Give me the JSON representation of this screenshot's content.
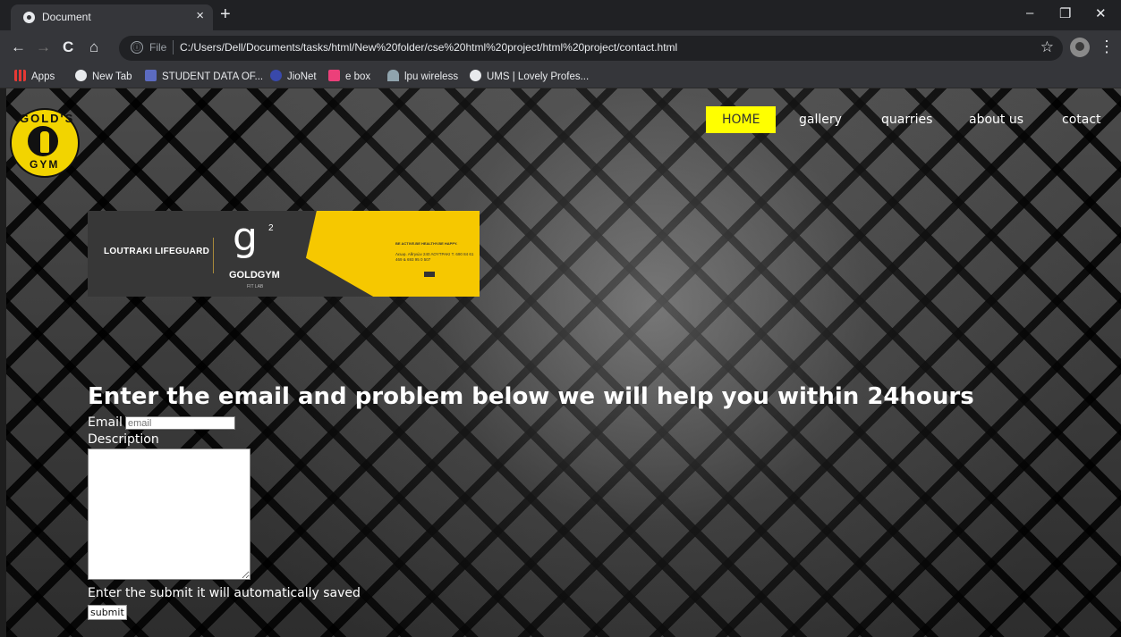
{
  "browser": {
    "tab_title": "Document",
    "tab_close": "×",
    "new_tab": "+",
    "window_controls": {
      "minimize": "–",
      "restore": "❐",
      "close": "✕"
    },
    "nav": {
      "back": "←",
      "forward": "→",
      "reload": "C",
      "home": "⌂"
    },
    "omnibox": {
      "info_icon": "ⓘ",
      "scheme": "File",
      "url": "C:/Users/Dell/Documents/tasks/html/New%20folder/cse%20html%20project/html%20project/contact.html",
      "star": "☆"
    },
    "menu": "⋮",
    "bookmarks": [
      {
        "label": "Apps",
        "icon": "apps-grid-icon",
        "color": "#e53935"
      },
      {
        "label": "New Tab",
        "icon": "globe-icon",
        "color": "#e8eaed"
      },
      {
        "label": "STUDENT DATA OF...",
        "icon": "list-icon",
        "color": "#5c6bc0"
      },
      {
        "label": "JioNet",
        "icon": "jio-icon",
        "color": "#3949ab"
      },
      {
        "label": "e box",
        "icon": "ebox-icon",
        "color": "#ec407a"
      },
      {
        "label": "lpu wireless",
        "icon": "wifi-icon",
        "color": "#90a4ae"
      },
      {
        "label": "UMS | Lovely Profes...",
        "icon": "globe-icon",
        "color": "#e8eaed"
      }
    ]
  },
  "site": {
    "logo": {
      "text_top": "GOLD'S",
      "text_bottom": "GYM"
    },
    "nav": [
      {
        "label": "HOME",
        "active": true
      },
      {
        "label": "gallery",
        "active": false
      },
      {
        "label": "quarries",
        "active": false
      },
      {
        "label": "about us",
        "active": false
      },
      {
        "label": "cotact",
        "active": false
      }
    ],
    "banner": {
      "left_text": "LOUTRAKI LIFEGUARD",
      "g_mark": "g",
      "g_superscript": "2",
      "brand": "GOLDGYM",
      "sub": "FIT LAB",
      "tagline": "BE ACTIVE.BE HEALTHY.BE HAPPY.",
      "address": "Λεωφ. Αθηνών 240 ΛΟΥΤΡΑΚΙ T. 690 84 61 469 & 693 95 0 507"
    },
    "heading": "Enter the email and problem below we will help you within 24hours",
    "email_label": "Email",
    "email_placeholder": "email",
    "description_label": "Description",
    "note": "Enter the submit it will automatically saved",
    "submit_label": "submit"
  },
  "colors": {
    "nav_active_bg": "#ffff00",
    "logo_yellow": "#f2d400",
    "banner_yellow": "#f6c800"
  }
}
